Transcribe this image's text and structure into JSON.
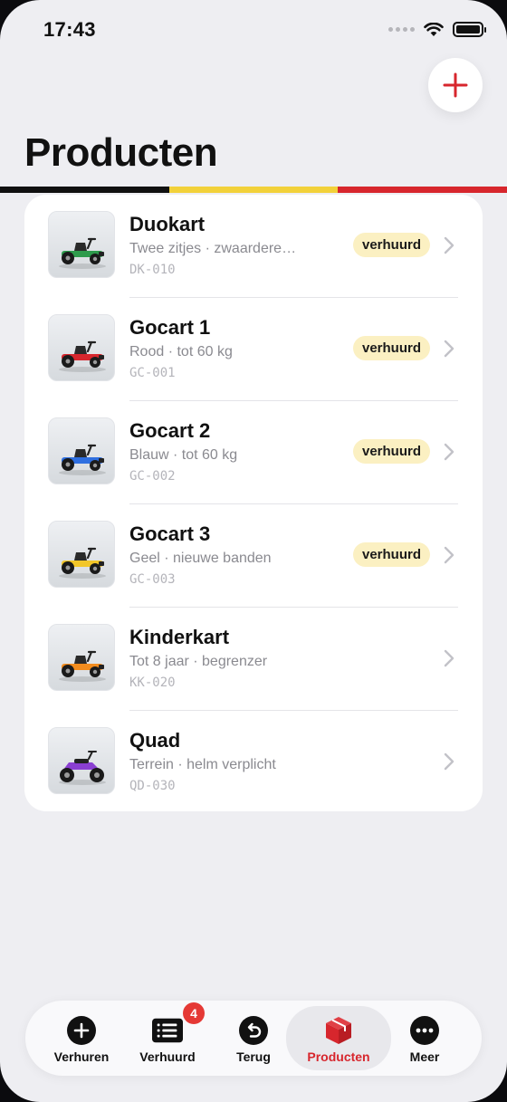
{
  "status_bar": {
    "time": "17:43"
  },
  "header": {
    "title": "Producten",
    "add_icon": "plus-icon"
  },
  "flag_colors": [
    "#111111",
    "#f2d13a",
    "#d7262d"
  ],
  "products": [
    {
      "title": "Duokart",
      "subtitle": "Twee zitjes · zwaardere…",
      "code": "DK-010",
      "badge": "verhuurd",
      "color": "#2e9b4c"
    },
    {
      "title": "Gocart 1",
      "subtitle": "Rood · tot 60 kg",
      "code": "GC-001",
      "badge": "verhuurd",
      "color": "#d7262d"
    },
    {
      "title": "Gocart 2",
      "subtitle": "Blauw · tot 60 kg",
      "code": "GC-002",
      "badge": "verhuurd",
      "color": "#2f6fe0"
    },
    {
      "title": "Gocart 3",
      "subtitle": "Geel · nieuwe banden",
      "code": "GC-003",
      "badge": "verhuurd",
      "color": "#f2c629"
    },
    {
      "title": "Kinderkart",
      "subtitle": "Tot 8 jaar · begrenzer",
      "code": "KK-020",
      "badge": "",
      "color": "#f28c1e"
    },
    {
      "title": "Quad",
      "subtitle": "Terrein · helm verplicht",
      "code": "QD-030",
      "badge": "",
      "color": "#8a3fd1"
    }
  ],
  "tabs": [
    {
      "label": "Verhuren",
      "icon": "plus-circle-icon"
    },
    {
      "label": "Verhuurd",
      "icon": "list-icon",
      "badge": "4"
    },
    {
      "label": "Terug",
      "icon": "return-icon"
    },
    {
      "label": "Producten",
      "icon": "box-icon"
    },
    {
      "label": "Meer",
      "icon": "more-icon"
    }
  ],
  "active_tab": "Producten",
  "accent_color": "#d7262d"
}
